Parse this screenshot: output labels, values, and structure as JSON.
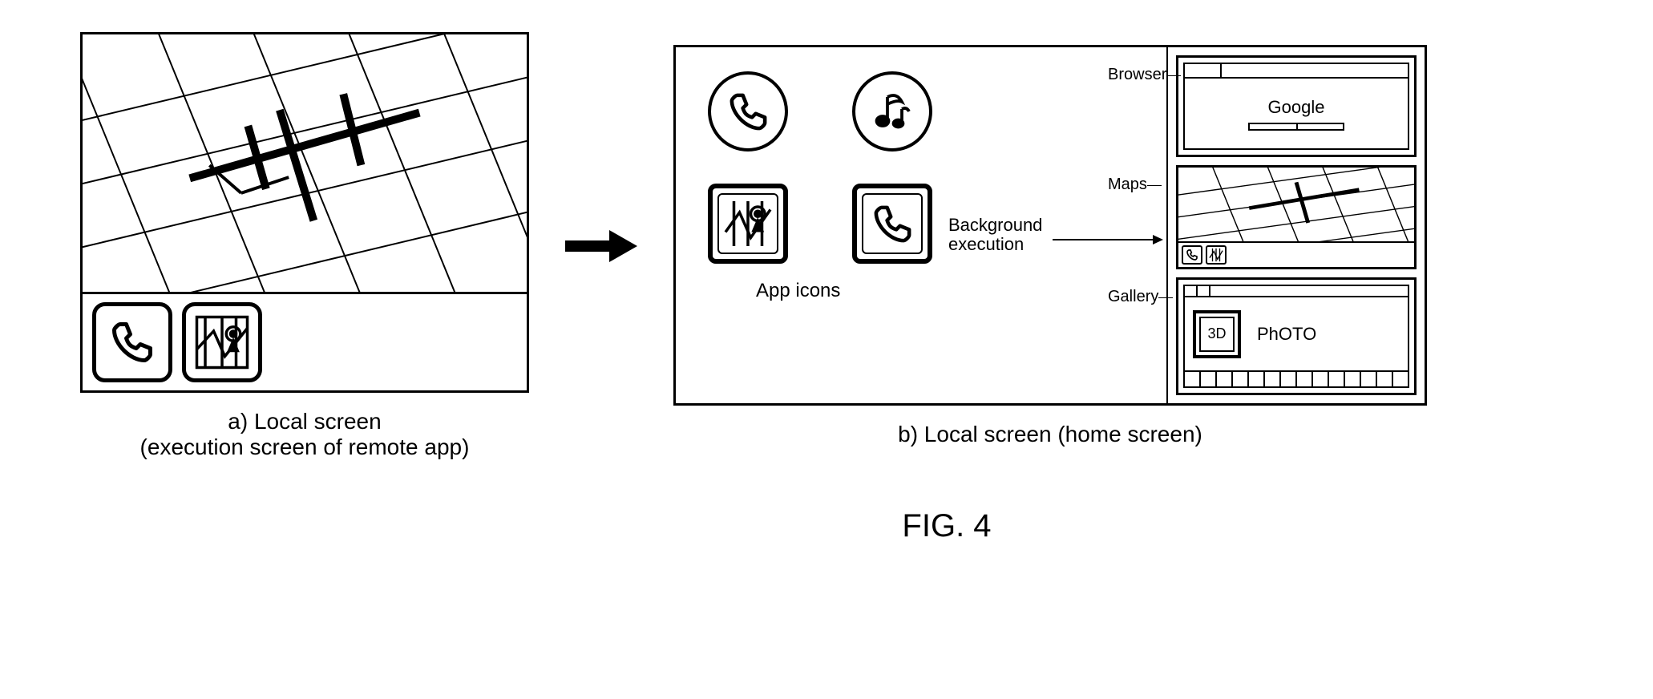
{
  "figure_label": "FIG. 4",
  "panel_a": {
    "caption_line1": "a) Local screen",
    "caption_line2": "(execution screen of remote app)"
  },
  "panel_b": {
    "caption": "b) Local screen (home screen)",
    "app_icons_label": "App icons",
    "background_execution_label": "Background\nexecution",
    "widgets": {
      "browser": {
        "label": "Browser",
        "title": "Google"
      },
      "maps": {
        "label": "Maps"
      },
      "gallery": {
        "label": "Gallery",
        "thumb_text": "3D",
        "photo_text": "PhOTO"
      }
    }
  }
}
